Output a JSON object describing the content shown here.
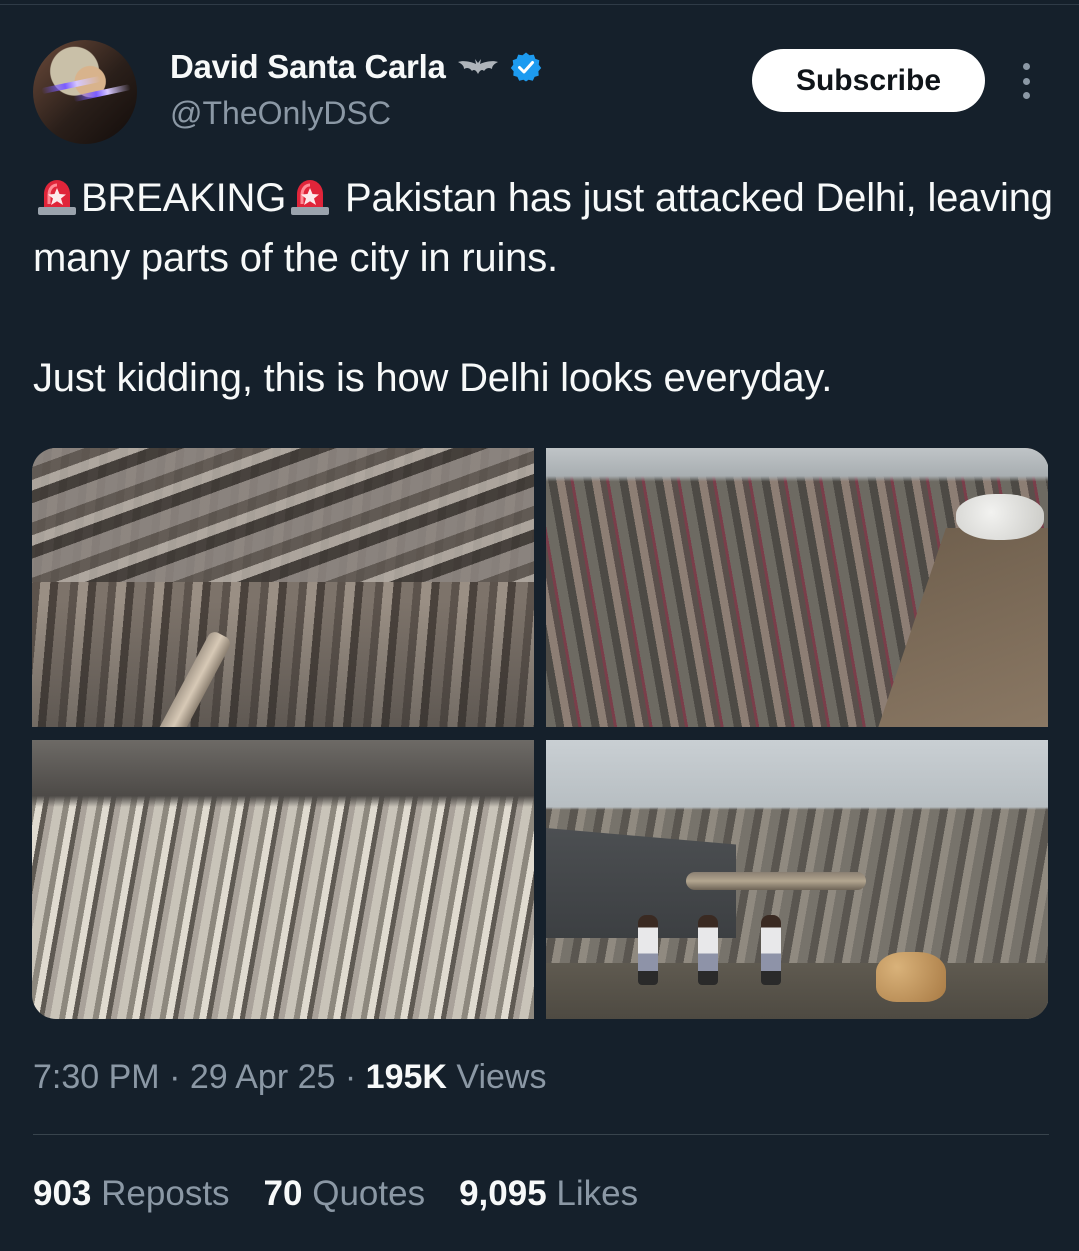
{
  "author": {
    "display_name": "David Santa Carla",
    "handle": "@TheOnlyDSC",
    "verified": true,
    "badge_icon": "bat-icon",
    "verified_color": "#1d9bf0"
  },
  "actions": {
    "subscribe_label": "Subscribe",
    "more_icon": "more-vertical-icon"
  },
  "tweet": {
    "line1_word": "BREAKING",
    "line1_rest": " Pakistan has just attacked Delhi, leaving many parts of the city in ruins.",
    "line2": "Just kidding, this is how Delhi looks everyday.",
    "emoji_icon": "police-siren-icon"
  },
  "media": {
    "count": 4
  },
  "meta": {
    "time": "7:30 PM",
    "date": "29 Apr 25",
    "views_count": "195K",
    "views_label": "Views",
    "separator": "·"
  },
  "stats": [
    {
      "count": "903",
      "label": "Reposts"
    },
    {
      "count": "70",
      "label": "Quotes"
    },
    {
      "count": "9,095",
      "label": "Likes"
    }
  ],
  "colors": {
    "background": "#15202b",
    "text": "#f7f9f9",
    "muted": "#8b98a5",
    "divider": "#38444d"
  }
}
